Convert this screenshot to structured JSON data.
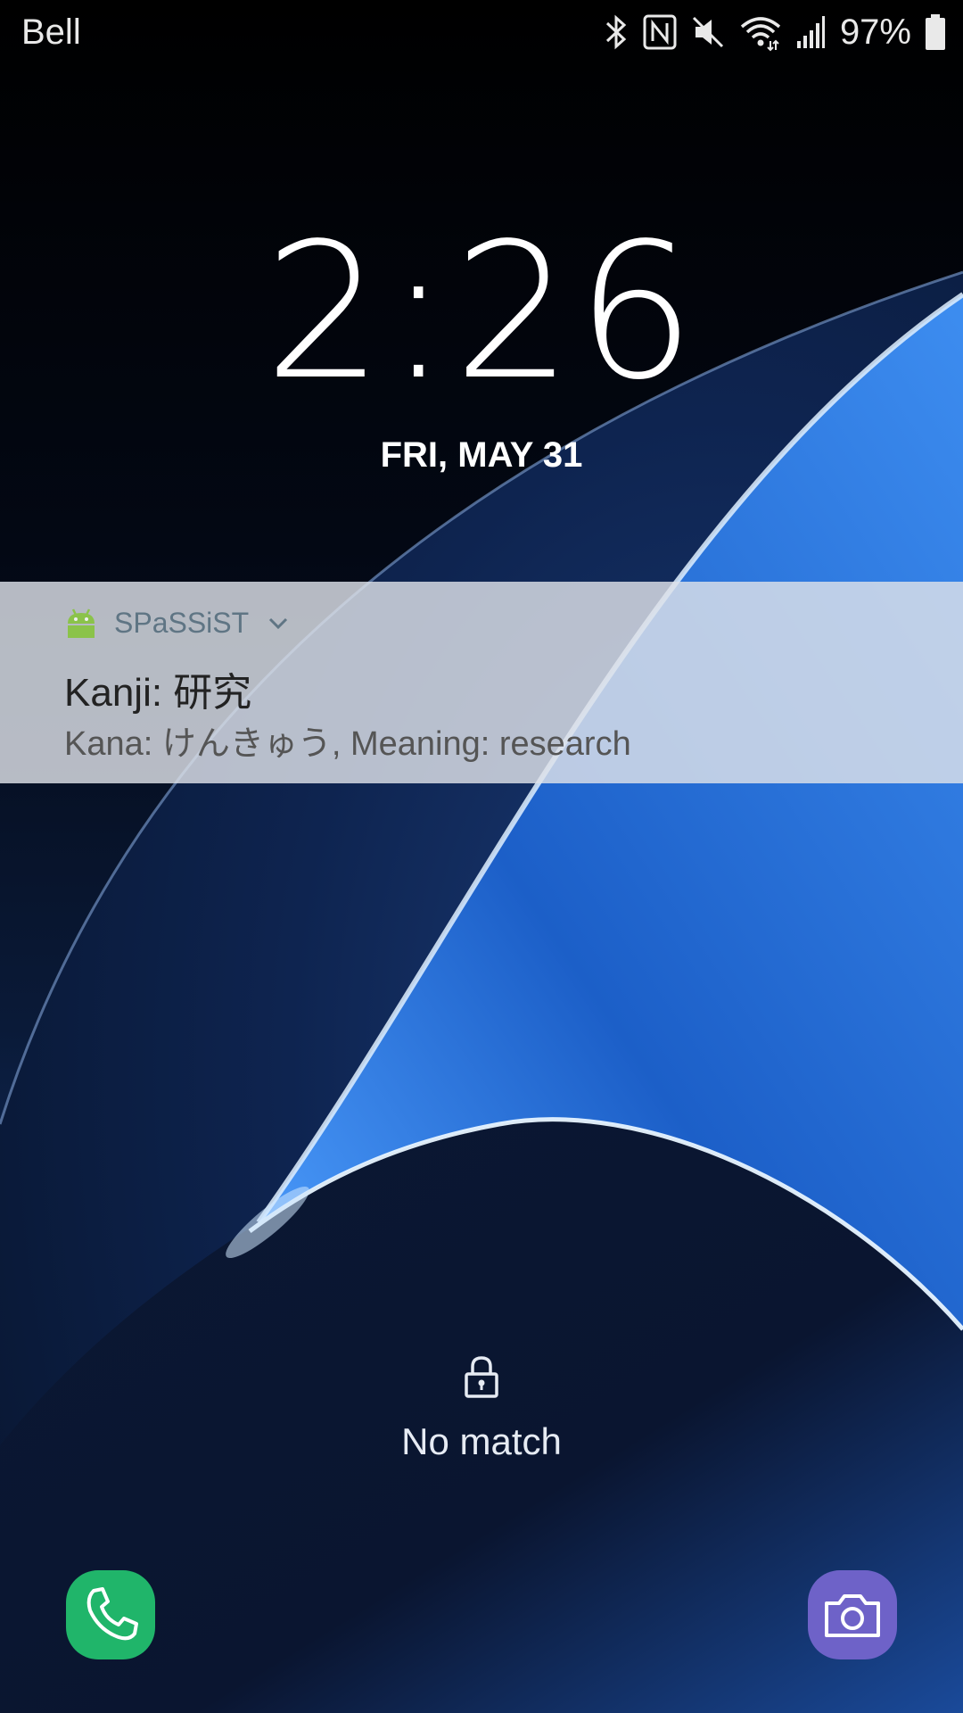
{
  "status_bar": {
    "carrier": "Bell",
    "battery_percent": "97%",
    "icons": [
      "bluetooth-icon",
      "nfc-icon",
      "mute-icon",
      "wifi-icon",
      "signal-icon",
      "battery-icon"
    ]
  },
  "lockscreen": {
    "time": "2:26",
    "date": "FRI, MAY 31"
  },
  "notification": {
    "app_name": "SPaSSiST",
    "app_icon": "android-icon",
    "title": "Kanji: 研究",
    "text": "Kana: けんきゅう, Meaning: research"
  },
  "unlock": {
    "status": "No match",
    "icon": "lock-icon"
  },
  "shortcuts": {
    "left": "phone-icon",
    "right": "camera-icon"
  },
  "colors": {
    "phone_bg": "#20b56a",
    "camera_bg": "#6e62c8",
    "notification_bg": "#dee2e9"
  }
}
